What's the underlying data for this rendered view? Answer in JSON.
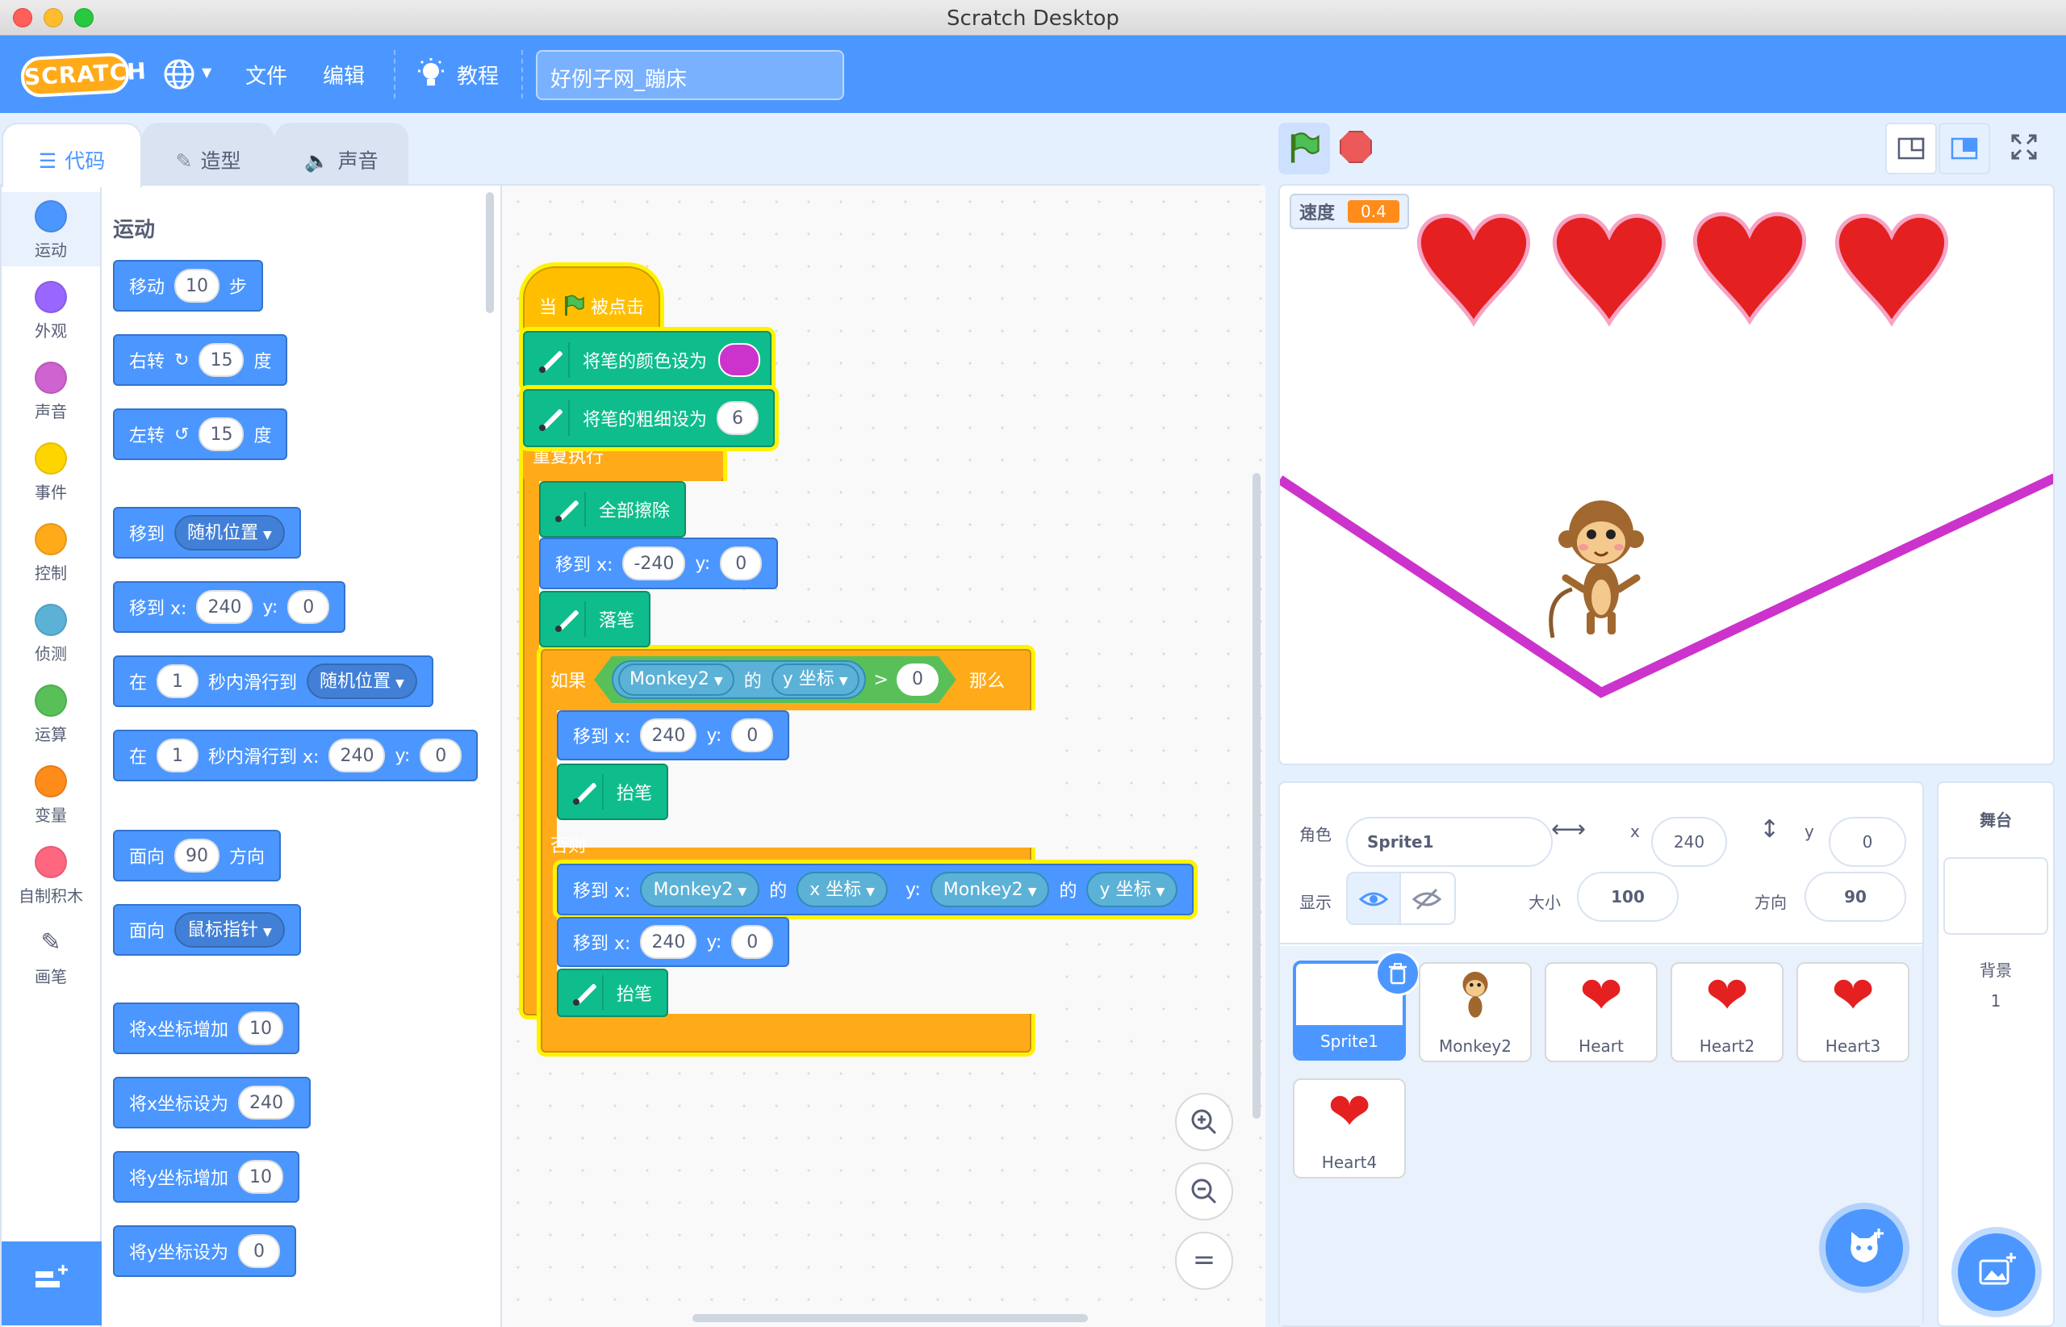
{
  "window": {
    "title": "Scratch Desktop"
  },
  "menubar": {
    "logo": "SCRATCH",
    "file": "文件",
    "edit": "编辑",
    "tutorials": "教程",
    "project_title": "好例子网_蹦床"
  },
  "tabs": [
    {
      "label": "代码"
    },
    {
      "label": "造型"
    },
    {
      "label": "声音"
    }
  ],
  "categories": [
    {
      "label": "运动",
      "color": "#4c97ff"
    },
    {
      "label": "外观",
      "color": "#9966ff"
    },
    {
      "label": "声音",
      "color": "#cf63cf"
    },
    {
      "label": "事件",
      "color": "#ffd500"
    },
    {
      "label": "控制",
      "color": "#ffab19"
    },
    {
      "label": "侦测",
      "color": "#5cb1d6"
    },
    {
      "label": "运算",
      "color": "#59c059"
    },
    {
      "label": "变量",
      "color": "#ff8c1a"
    },
    {
      "label": "自制积木",
      "color": "#ff6680"
    },
    {
      "label": "画笔",
      "color": "#0fbd8c"
    }
  ],
  "palette": {
    "title": "运动",
    "move": {
      "pre": "移动",
      "n": "10",
      "post": "步"
    },
    "turn_right": {
      "pre": "右转",
      "n": "15",
      "post": "度"
    },
    "turn_left": {
      "pre": "左转",
      "n": "15",
      "post": "度"
    },
    "goto": {
      "pre": "移到",
      "opt": "随机位置"
    },
    "goto_xy": {
      "pre": "移到 x:",
      "x": "240",
      "ylbl": "y:",
      "y": "0"
    },
    "glide": {
      "pre": "在",
      "n": "1",
      "mid": "秒内滑行到",
      "opt": "随机位置"
    },
    "glide_xy": {
      "pre": "在",
      "n": "1",
      "mid": "秒内滑行到 x:",
      "x": "240",
      "ylbl": "y:",
      "y": "0"
    },
    "point_dir": {
      "pre": "面向",
      "n": "90",
      "post": "方向"
    },
    "point_to": {
      "pre": "面向",
      "opt": "鼠标指针"
    },
    "change_x": {
      "pre": "将x坐标增加",
      "n": "10"
    },
    "set_x": {
      "pre": "将x坐标设为",
      "n": "240"
    },
    "change_y": {
      "pre": "将y坐标增加",
      "n": "10"
    },
    "set_y": {
      "pre": "将y坐标设为",
      "n": "0"
    }
  },
  "script": {
    "hat": {
      "pre": "当",
      "post": "被点击"
    },
    "set_pen_color": {
      "label": "将笔的颜色设为",
      "color": "#cc33cc"
    },
    "set_pen_size": {
      "label": "将笔的粗细设为",
      "n": "6"
    },
    "forever": "重复执行",
    "clear": "全部擦除",
    "goto1": {
      "pre": "移到 x:",
      "x": "-240",
      "ylbl": "y:",
      "y": "0"
    },
    "pen_down": "落笔",
    "if": {
      "pre": "如果",
      "sprite": "Monkey2",
      "of": "的",
      "prop": "y 坐标",
      "op": ">",
      "n": "0",
      "then": "那么"
    },
    "goto2": {
      "pre": "移到 x:",
      "x": "240",
      "ylbl": "y:",
      "y": "0"
    },
    "pen_up1": "抬笔",
    "else": "否则",
    "goto3": {
      "pre": "移到 x:",
      "sprite1": "Monkey2",
      "of1": "的",
      "prop1": "x 坐标",
      "ylbl": "y:",
      "sprite2": "Monkey2",
      "of2": "的",
      "prop2": "y 坐标"
    },
    "goto4": {
      "pre": "移到 x:",
      "x": "240",
      "ylbl": "y:",
      "y": "0"
    },
    "pen_up2": "抬笔"
  },
  "zoom": {
    "reset": "="
  },
  "stage": {
    "variable": {
      "name": "速度",
      "value": "0.4"
    },
    "line_color": "#cc33cc"
  },
  "sprite_info": {
    "sprite_label": "角色",
    "sprite_name": "Sprite1",
    "x_label": "x",
    "x": "240",
    "y_label": "y",
    "y": "0",
    "show_label": "显示",
    "size_label": "大小",
    "size": "100",
    "direction_label": "方向",
    "direction": "90"
  },
  "sprites": [
    {
      "name": "Sprite1",
      "selected": true
    },
    {
      "name": "Monkey2"
    },
    {
      "name": "Heart"
    },
    {
      "name": "Heart2"
    },
    {
      "name": "Heart3"
    },
    {
      "name": "Heart4"
    }
  ],
  "stage_pane": {
    "title": "舞台",
    "backdrop_label": "背景",
    "backdrop_count": "1"
  }
}
